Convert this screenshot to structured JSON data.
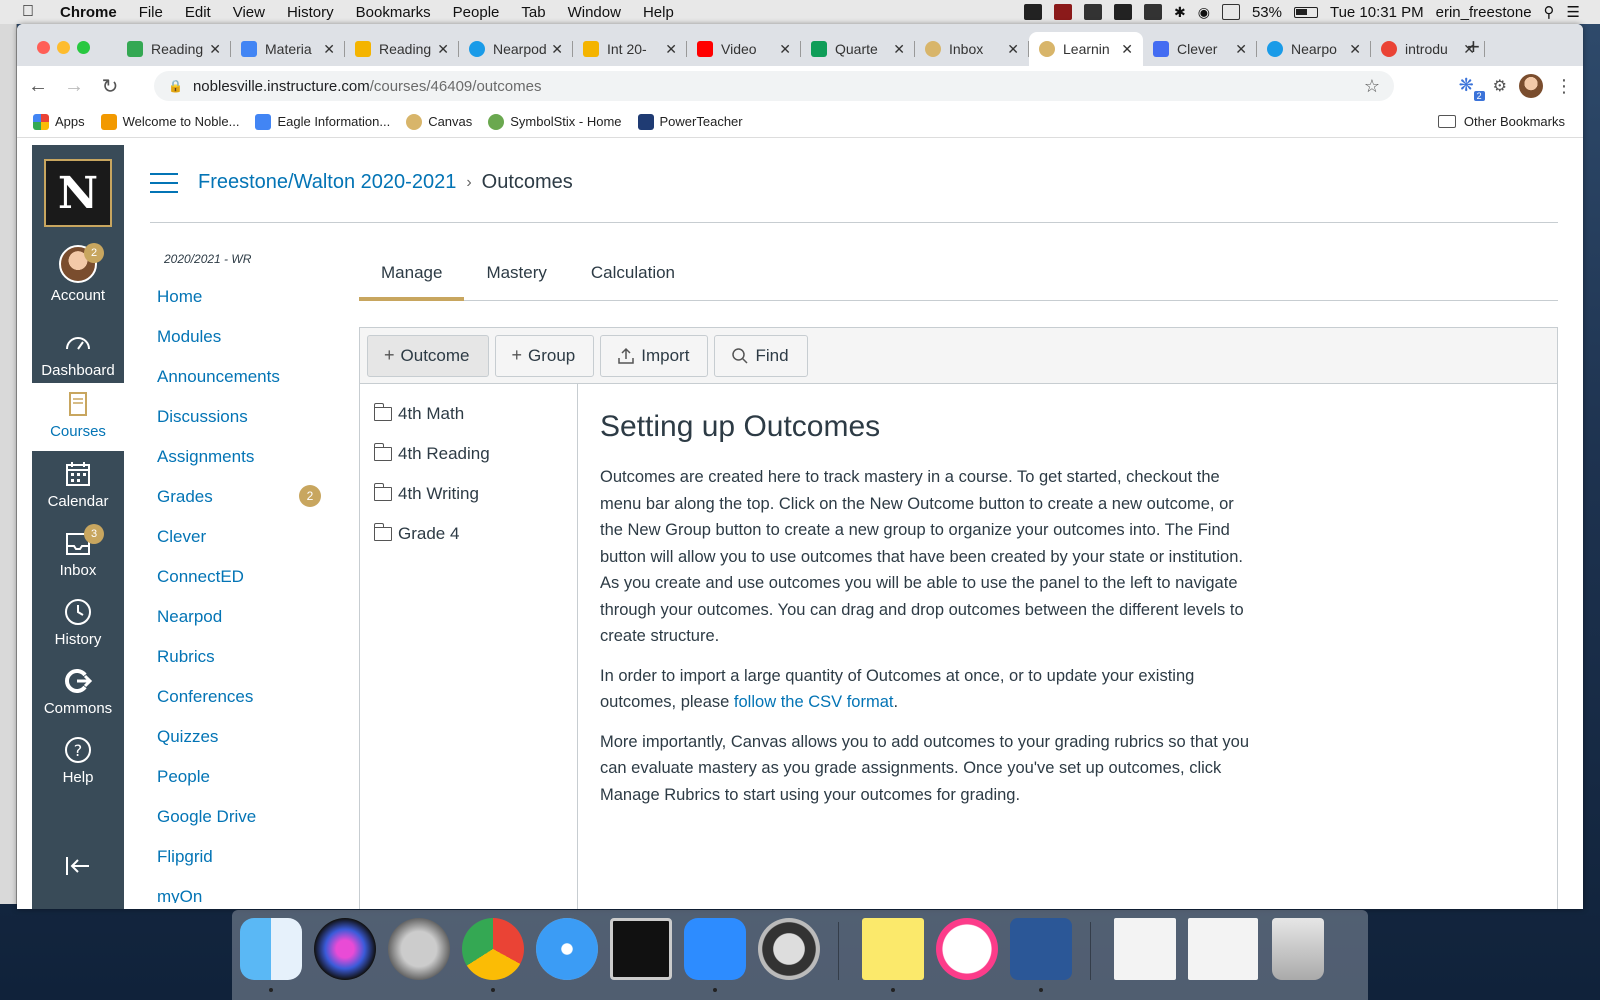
{
  "menubar": {
    "app": "Chrome",
    "items": [
      "File",
      "Edit",
      "View",
      "History",
      "Bookmarks",
      "People",
      "Tab",
      "Window",
      "Help"
    ],
    "battery": "53%",
    "clock": "Tue 10:31 PM",
    "user": "erin_freestone"
  },
  "browser": {
    "tabs": [
      {
        "title": "Reading",
        "color": "#34a853"
      },
      {
        "title": "Materia",
        "color": "#4285f4"
      },
      {
        "title": "Reading",
        "color": "#f4b400"
      },
      {
        "title": "Nearpod",
        "color": "#1a9be8"
      },
      {
        "title": "Int 20-",
        "color": "#f4b400"
      },
      {
        "title": "Video",
        "color": "#ff0000"
      },
      {
        "title": "Quarte",
        "color": "#0f9d58"
      },
      {
        "title": "Inbox",
        "color": "#d8b56a"
      },
      {
        "title": "Learnin",
        "color": "#d8b56a"
      },
      {
        "title": "Clever",
        "color": "#436cf2"
      },
      {
        "title": "Nearpo",
        "color": "#1a9be8"
      },
      {
        "title": "introdu",
        "color": "#ea4335"
      }
    ],
    "url_host": "noblesville.instructure.com",
    "url_path": "/courses/46409/outcomes",
    "bookmarks": [
      {
        "label": "Apps",
        "color": "#ea4335"
      },
      {
        "label": "Welcome to Noble...",
        "color": "#f29900"
      },
      {
        "label": "Eagle Information...",
        "color": "#4285f4"
      },
      {
        "label": "Canvas",
        "color": "#d8b56a"
      },
      {
        "label": "SymbolStix - Home",
        "color": "#6aa84f"
      },
      {
        "label": "PowerTeacher",
        "color": "#1f3b73"
      }
    ],
    "other_bookmarks": "Other Bookmarks",
    "extension_badge": "2"
  },
  "global_nav": {
    "logo": "N",
    "items": [
      {
        "label": "Account",
        "badge": "2"
      },
      {
        "label": "Dashboard"
      },
      {
        "label": "Courses"
      },
      {
        "label": "Calendar"
      },
      {
        "label": "Inbox",
        "badge": "3"
      },
      {
        "label": "History"
      },
      {
        "label": "Commons"
      },
      {
        "label": "Help"
      }
    ]
  },
  "breadcrumb": {
    "course": "Freestone/Walton 2020-2021",
    "current": "Outcomes"
  },
  "course_nav": {
    "term": "2020/2021 - WR",
    "items": [
      {
        "label": "Home"
      },
      {
        "label": "Modules"
      },
      {
        "label": "Announcements"
      },
      {
        "label": "Discussions"
      },
      {
        "label": "Assignments"
      },
      {
        "label": "Grades",
        "badge": "2"
      },
      {
        "label": "Clever"
      },
      {
        "label": "ConnectED"
      },
      {
        "label": "Nearpod"
      },
      {
        "label": "Rubrics"
      },
      {
        "label": "Conferences"
      },
      {
        "label": "Quizzes"
      },
      {
        "label": "People"
      },
      {
        "label": "Google Drive"
      },
      {
        "label": "Flipgrid"
      },
      {
        "label": "myOn"
      }
    ]
  },
  "outcome_tabs": [
    "Manage",
    "Mastery",
    "Calculation"
  ],
  "toolbar_buttons": [
    {
      "label": "Outcome",
      "icon": "+"
    },
    {
      "label": "Group",
      "icon": "+"
    },
    {
      "label": "Import",
      "icon": "upload"
    },
    {
      "label": "Find",
      "icon": "search"
    }
  ],
  "folders": [
    "4th Math",
    "4th Reading",
    "4th Writing",
    "Grade 4"
  ],
  "content": {
    "heading": "Setting up Outcomes",
    "p1": "Outcomes are created here to track mastery in a course. To get started, checkout the menu bar along the top. Click on the New Outcome button to create a new outcome, or the New Group button to create a new group to organize your outcomes into. The Find button will allow you to use outcomes that have been created by your state or institution. As you create and use outcomes you will be able to use the panel to the left to navigate through your outcomes. You can drag and drop outcomes between the different levels to create structure.",
    "p2_before": "In order to import a large quantity of Outcomes at once, or to update your existing outcomes, please ",
    "p2_link": "follow the CSV format",
    "p2_after": ".",
    "p3": "More importantly, Canvas allows you to add outcomes to your grading rubrics so that you can evaluate mastery as you grade assignments. Once you've set up outcomes, click Manage Rubrics to start using your outcomes for grading."
  }
}
